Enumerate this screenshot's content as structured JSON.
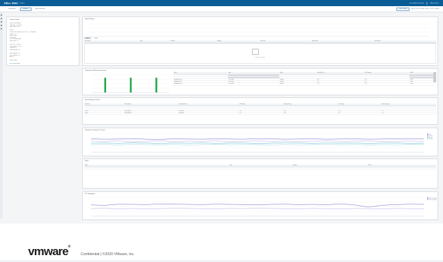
{
  "topbar": {
    "logo": "DELL EMC",
    "product": "vRealize",
    "user": "Grace Admin (Example)",
    "menu": "Administration"
  },
  "tabs": [
    {
      "label": "Dashboards"
    },
    {
      "label": "Reports"
    },
    {
      "label": "Add Dashboard"
    }
  ],
  "time_range": {
    "button": "Last 7 Days",
    "text": "Sep 3 2020, 9:00 AM - Sep 10 2020, 9:00 AM"
  },
  "left_panel": {
    "title": "Cluster Details",
    "facts": [
      "Name: cluster-prod-01",
      "Datacenter: DC-West-01",
      "Type: vSAN Cluster",
      "",
      "Hosts: 4",
      "vCenter: vc01.corp.local (10.110.0.21) - Connected",
      "Version: 7.0.1",
      "Health: Green",
      "HA: Enabled",
      "DRS: Fully Automated",
      "Power State: On",
      "",
      "Total CPU: 153.6 GHz",
      "Total Memory: 1.02 TB",
      "Datastores: 3",
      "Virtual Machines: 42",
      "",
      "Used Capacity: 41 %",
      "Free Capacity: 59 %",
      "Alerts: 0",
      "",
      "Policy: Default"
    ],
    "link": "View Cluster Details"
  },
  "alerts_widget": {
    "title": "Health History",
    "legend": [
      "Critical",
      "Warning",
      "Info"
    ],
    "tabs": [
      "Alerts",
      "Events"
    ],
    "columns": [
      "Alert Name",
      "Type",
      "Criticality",
      "Subtype",
      "Start Time",
      "Object Name",
      "Control State"
    ],
    "empty_text": "No data to display"
  },
  "capacity_widget": {
    "title": "Component Utilization Summary",
    "columns": [
      "Name",
      "Type",
      "Status",
      "Capacity Used",
      "Free Capacity",
      "Health"
    ],
    "rows": [
      [
        "cluster-01",
        "vSAN Datastore",
        "Connected",
        "41%",
        "59%",
        "Green"
      ],
      [
        "cluster-02",
        "vSAN Datastore",
        "Connected",
        "38%",
        "62%",
        "Green"
      ],
      [
        "diskgroup-esx-01",
        "Disk Group",
        "Healthy",
        "44%",
        "56%",
        "Green"
      ],
      [
        "diskgroup-esx-02",
        "Disk Group",
        "Healthy",
        "39%",
        "61%",
        "Green"
      ],
      [
        "diskgroup-esx-03",
        "Disk Group",
        "Healthy",
        "42%",
        "58%",
        "Green"
      ]
    ]
  },
  "hosts_widget": {
    "title": "Host Utilization Details",
    "columns": [
      "Hostname",
      "Cluster Name",
      "Connection State",
      "CPU Usage",
      "Memory Usage",
      "Disk Usage",
      "Network Usage"
    ],
    "rows": [
      [
        "esx-01",
        "cluster-prod-01",
        "Connected",
        "34%",
        "61%",
        "12%",
        "8%"
      ],
      [
        "esx-02",
        "cluster-prod-01",
        "Connected",
        "29%",
        "58%",
        "10%",
        "6%"
      ],
      [
        "esx-03",
        "cluster-prod-01",
        "Connected",
        "31%",
        "63%",
        "11%",
        "7%"
      ],
      [
        "esx-04",
        "cluster-prod-01",
        "Connected",
        "27%",
        "55%",
        "9%",
        "5%"
      ]
    ]
  },
  "trend_widget": {
    "title": "Utilization Trend (Last 7 Days)",
    "legend": [
      "CPU",
      "Memory",
      "Storage",
      "Network"
    ]
  },
  "ssd_widget": {
    "title": "SSDs",
    "columns": [
      "Name",
      "Host",
      "Capacity",
      "Status"
    ],
    "rows": [
      [
        "naa.5000c500a1b2",
        "esx-01",
        "800 GB",
        "Healthy"
      ]
    ]
  },
  "io_widget": {
    "title": "I/O Throughput",
    "legend": [
      "Read Throughput",
      "Write Throughput"
    ]
  },
  "chart_data": [
    {
      "type": "line",
      "title": "Health History",
      "series": [],
      "x": [],
      "ylim": [
        0,
        100
      ]
    },
    {
      "type": "bar",
      "title": "Component Utilization Summary",
      "categories": [
        "cluster-01",
        "cluster-02",
        "cluster-03"
      ],
      "values": [
        100,
        100,
        100
      ],
      "ylim": [
        0,
        120
      ]
    },
    {
      "type": "line",
      "title": "Utilization Trend (Last 7 Days)",
      "x": [
        1,
        2,
        3,
        4,
        5,
        6,
        7,
        8,
        9,
        10,
        11,
        12,
        13,
        14,
        15,
        16,
        17,
        18,
        19,
        20,
        21,
        22,
        23,
        24,
        25
      ],
      "series": [
        {
          "name": "CPU",
          "values": [
            72,
            70,
            71,
            73,
            70,
            69,
            72,
            71,
            70,
            72,
            71,
            70,
            73,
            72,
            70,
            71,
            72,
            70,
            71,
            72,
            70,
            71,
            73,
            72,
            71
          ]
        },
        {
          "name": "Memory",
          "values": [
            60,
            58,
            62,
            55,
            59,
            61,
            57,
            60,
            58,
            62,
            56,
            59,
            61,
            58,
            60,
            57,
            59,
            62,
            58,
            60,
            61,
            57,
            59,
            60,
            58
          ]
        },
        {
          "name": "Storage",
          "values": [
            48,
            50,
            47,
            52,
            49,
            46,
            50,
            48,
            51,
            47,
            49,
            50,
            46,
            48,
            52,
            49,
            47,
            50,
            48,
            51,
            46,
            49,
            50,
            47,
            48
          ]
        },
        {
          "name": "Network",
          "values": [
            40,
            42,
            39,
            43,
            41,
            40,
            42,
            39,
            41,
            43,
            40,
            42,
            41,
            39,
            42,
            40,
            41,
            43,
            40,
            42,
            39,
            41,
            40,
            42,
            41
          ]
        }
      ],
      "ylim": [
        0,
        100
      ]
    },
    {
      "type": "line",
      "title": "I/O Throughput",
      "x": [
        1,
        2,
        3,
        4,
        5,
        6,
        7,
        8,
        9,
        10,
        11,
        12,
        13,
        14,
        15,
        16,
        17,
        18,
        19,
        20,
        21,
        22,
        23,
        24,
        25
      ],
      "series": [
        {
          "name": "Read Throughput",
          "values": [
            60,
            58,
            64,
            63,
            62,
            65,
            64,
            63,
            62,
            64,
            63,
            62,
            61,
            63,
            64,
            62,
            63,
            61,
            66,
            60,
            48,
            58,
            62,
            64,
            63
          ]
        },
        {
          "name": "Write Throughput",
          "values": [
            40,
            42,
            38,
            41,
            39,
            40,
            42,
            41,
            40,
            39,
            41,
            40,
            42,
            41,
            40,
            39,
            41,
            40,
            38,
            41,
            40,
            39,
            41,
            40,
            39
          ]
        }
      ],
      "ylim": [
        0,
        100
      ]
    }
  ],
  "footer": {
    "brand": "vmware",
    "confidential": "Confidential  |  ©2020 VMware, Inc."
  },
  "colors": {
    "topbar": "#0a5c96",
    "bar": "#1ea84a",
    "series": [
      "#6c5fc7",
      "#b3a6e8",
      "#4cb8c4",
      "#9cd6de"
    ]
  }
}
